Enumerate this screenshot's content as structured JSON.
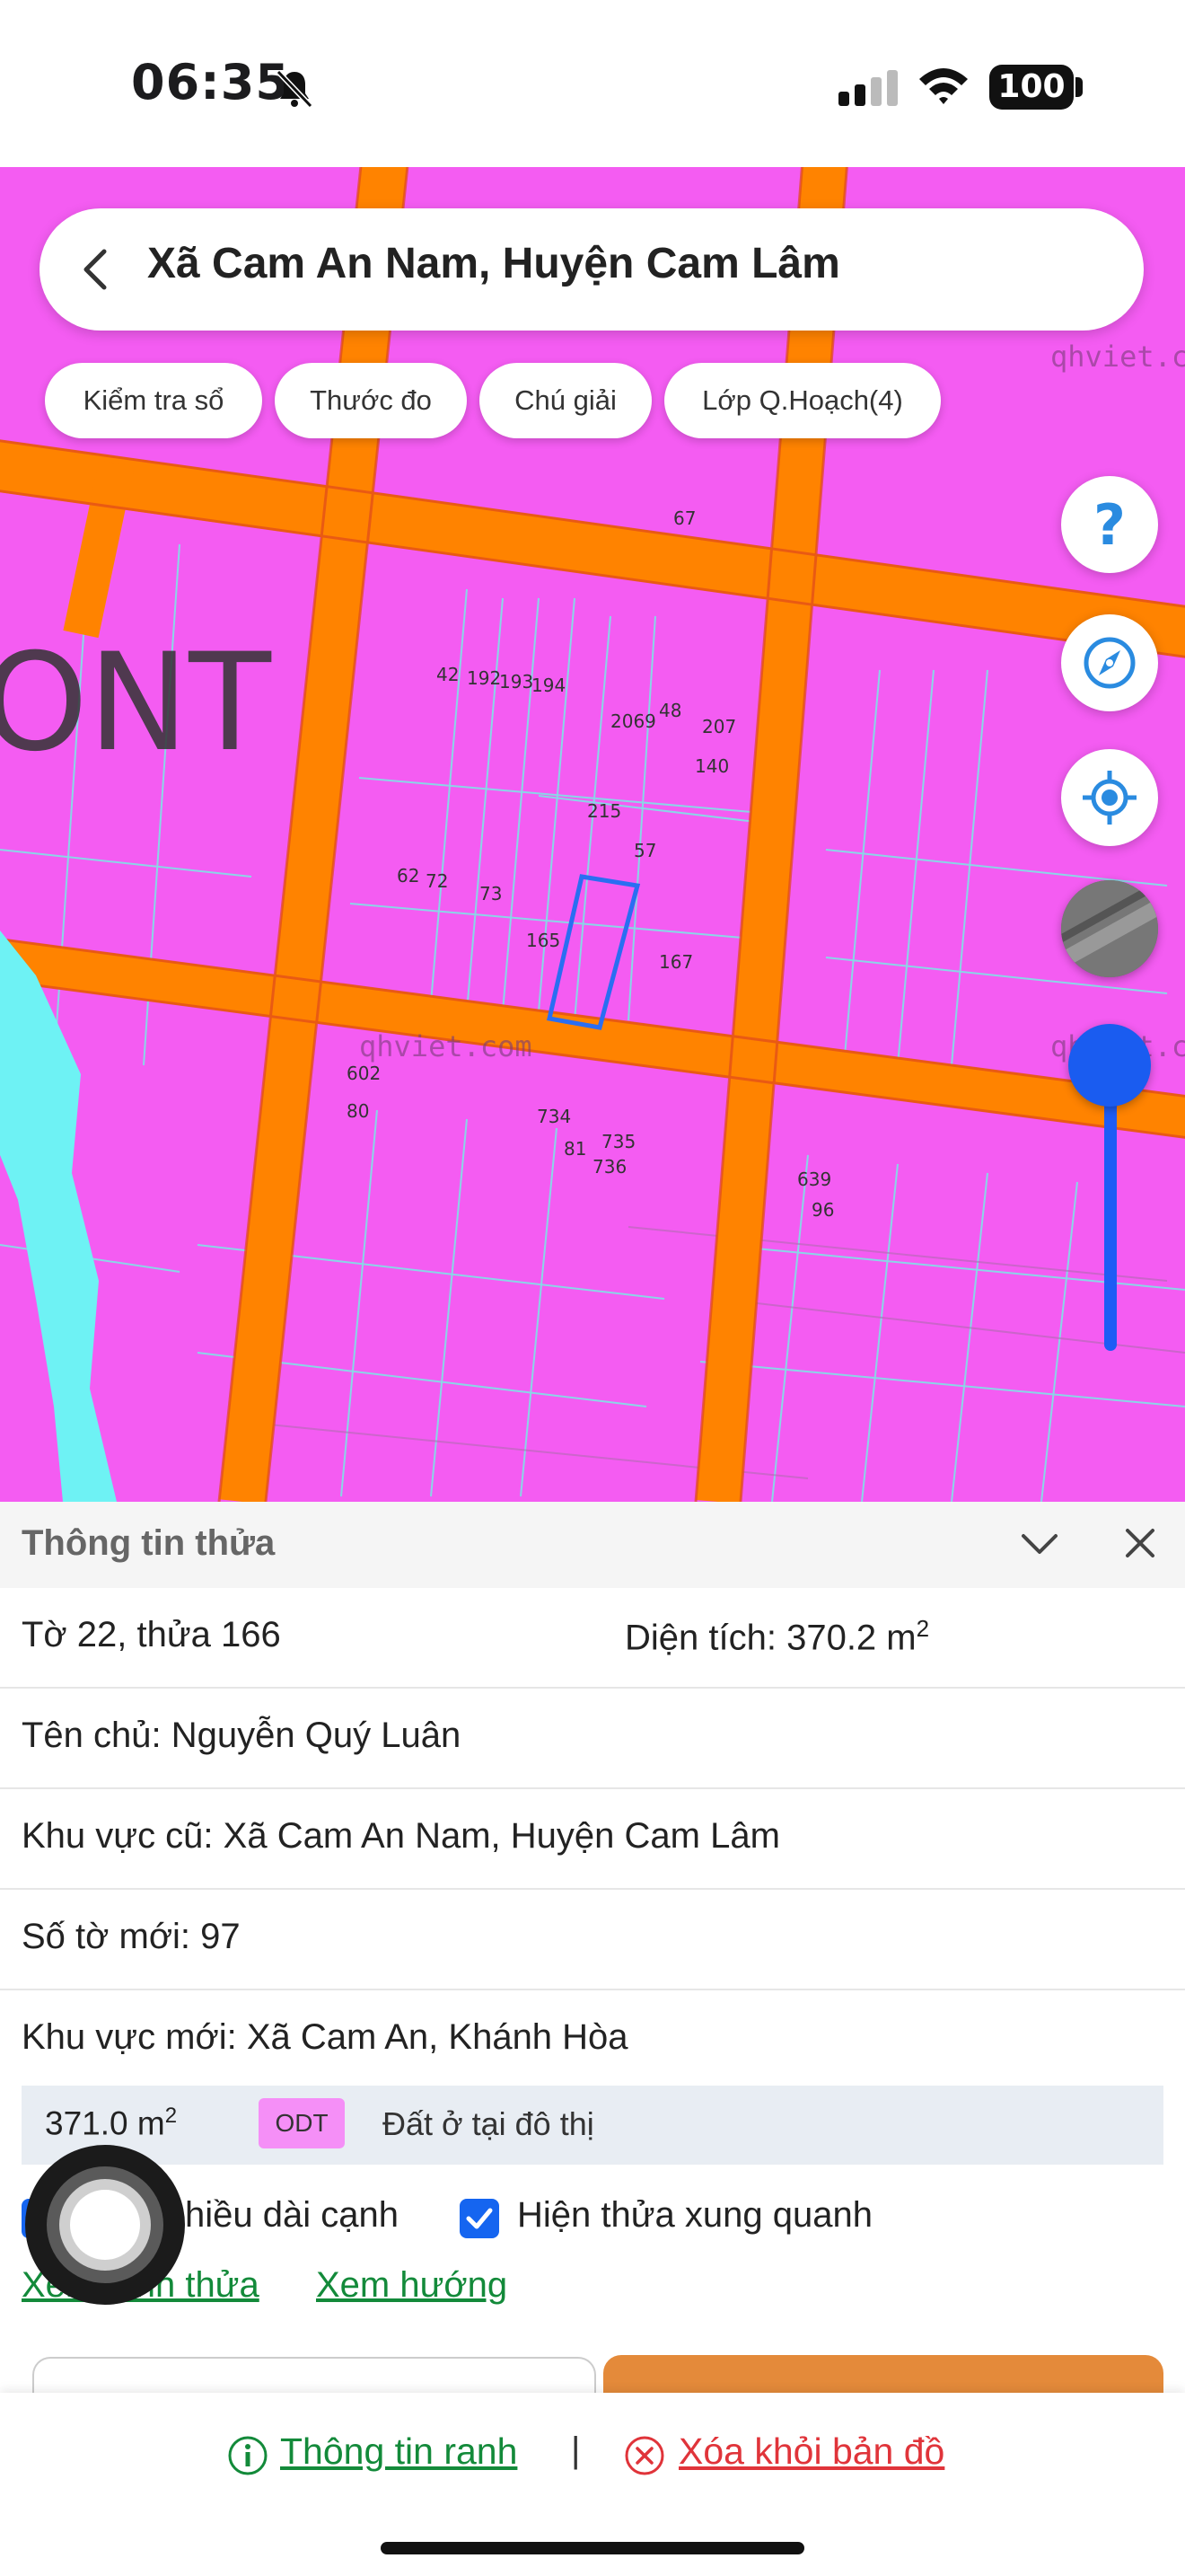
{
  "status_bar": {
    "time": "06:35",
    "battery": "100"
  },
  "search": {
    "title": "Xã Cam An Nam, Huyện Cam Lâm"
  },
  "chips": [
    "Kiểm tra sổ",
    "Thước đo",
    "Chú giải",
    "Lớp Q.Hoạch(4)"
  ],
  "map": {
    "zone_label": "ONT",
    "watermark": "qhviet.com",
    "parcel_numbers": [
      "67",
      "42",
      "192",
      "193",
      "194",
      "2069",
      "48",
      "207",
      "140",
      "215",
      "57",
      "62",
      "72",
      "73",
      "165",
      "167",
      "602",
      "80",
      "734",
      "81",
      "735",
      "736",
      "639",
      "96"
    ],
    "colors": {
      "land": "#f45cf2",
      "road": "#ff8300",
      "boundary": "#7fe3e6",
      "river": "#6ef2f4",
      "selected_parcel": "#2a6ef2"
    }
  },
  "panel": {
    "title": "Thông tin thửa",
    "sheet_parcel": "Tờ 22, thửa 166",
    "area_label": "Diện tích: 370.2 m",
    "area_sup": "2",
    "owner": "Tên chủ: Nguyễn Quý Luân",
    "old_area": "Khu vực cũ: Xã Cam An Nam, Huyện Cam Lâm",
    "new_sheet": "Số tờ mới: 97",
    "new_area": "Khu vực mới: Xã Cam An, Khánh Hòa",
    "land_use": {
      "area": "371.0 m",
      "area_sup": "2",
      "code": "ODT",
      "description": "Đất ở tại đô thị"
    },
    "checkbox_edge_length": "hiều dài cạnh",
    "checkbox_neighbors": "Hiện thửa xung quanh",
    "link_view_parcel": "Xem hình thửa",
    "link_view_direction": "Xem hướng"
  },
  "bottom": {
    "info_link": "Thông tin ranh",
    "separator": "|",
    "remove_link": "Xóa khỏi bản đồ"
  }
}
